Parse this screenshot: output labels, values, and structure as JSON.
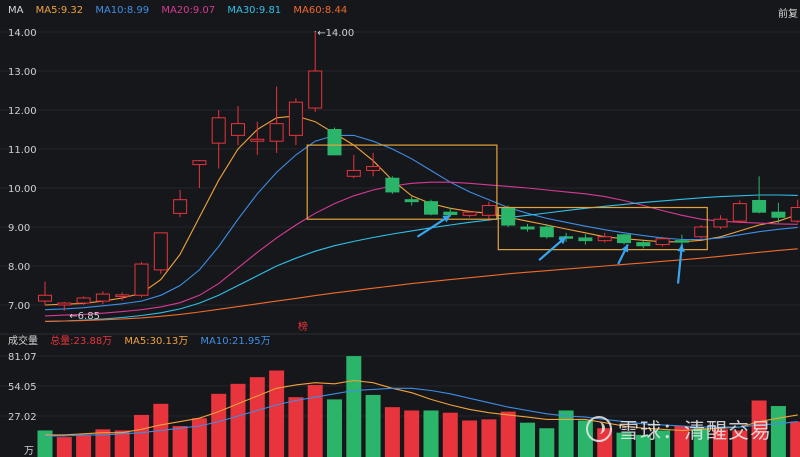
{
  "legend": {
    "ma_label": "MA",
    "ma5": "MA5:9.32",
    "ma10": "MA10:8.99",
    "ma20": "MA20:9.07",
    "ma30": "MA30:9.81",
    "ma60": "MA60:8.44"
  },
  "nav": {
    "right_label": "前复"
  },
  "volume_legend": {
    "title": "成交量",
    "total": "总量:23.88万",
    "ma5": "MA5:30.13万",
    "ma10": "MA10:21.95万"
  },
  "watermark": {
    "text": "雪球：清醒交易"
  },
  "colors": {
    "up": "#e8343c",
    "down": "#2ab56a",
    "ma5": "#f0a23b",
    "ma10": "#3e8ee6",
    "ma20": "#d63a94",
    "ma30": "#2fc0e8",
    "ma60": "#f06a2b",
    "annotation_box": "#e2a33b",
    "arrow": "#38a6ee"
  },
  "chart_data": [
    {
      "type": "candlestick",
      "title": "",
      "xlabel": "",
      "ylabel": "",
      "ylim": [
        6.55,
        14.3
      ],
      "yticks": [
        "14.00",
        "13.00",
        "12.00",
        "11.00",
        "10.00",
        "9.00",
        "8.00",
        "7.00"
      ],
      "ytick_values": [
        14,
        13,
        12,
        11,
        10,
        9,
        8,
        7
      ],
      "annotations": {
        "high": "←14.00",
        "low": "←6.85",
        "marker": "榜"
      },
      "candles": [
        {
          "o": 7.1,
          "h": 7.6,
          "l": 7.0,
          "c": 7.25
        },
        {
          "o": 7.0,
          "h": 7.08,
          "l": 6.85,
          "c": 7.05
        },
        {
          "o": 7.05,
          "h": 7.22,
          "l": 7.0,
          "c": 7.18
        },
        {
          "o": 7.1,
          "h": 7.35,
          "l": 7.02,
          "c": 7.28
        },
        {
          "o": 7.22,
          "h": 7.32,
          "l": 7.12,
          "c": 7.26
        },
        {
          "o": 7.25,
          "h": 8.1,
          "l": 7.2,
          "c": 8.05
        },
        {
          "o": 7.9,
          "h": 8.85,
          "l": 7.8,
          "c": 8.85
        },
        {
          "o": 9.35,
          "h": 9.95,
          "l": 9.25,
          "c": 9.7
        },
        {
          "o": 10.6,
          "h": 10.72,
          "l": 10.0,
          "c": 10.7
        },
        {
          "o": 11.15,
          "h": 12.0,
          "l": 10.5,
          "c": 11.8
        },
        {
          "o": 11.35,
          "h": 12.1,
          "l": 11.1,
          "c": 11.65
        },
        {
          "o": 11.2,
          "h": 11.7,
          "l": 10.85,
          "c": 11.25
        },
        {
          "o": 11.2,
          "h": 12.6,
          "l": 10.9,
          "c": 11.65
        },
        {
          "o": 11.35,
          "h": 12.3,
          "l": 11.1,
          "c": 12.2
        },
        {
          "o": 12.05,
          "h": 14.0,
          "l": 11.95,
          "c": 13.0
        },
        {
          "o": 11.5,
          "h": 11.55,
          "l": 10.85,
          "c": 10.85
        },
        {
          "o": 10.3,
          "h": 10.85,
          "l": 10.25,
          "c": 10.45
        },
        {
          "o": 10.45,
          "h": 10.9,
          "l": 10.3,
          "c": 10.55
        },
        {
          "o": 10.25,
          "h": 10.3,
          "l": 9.85,
          "c": 9.9
        },
        {
          "o": 9.7,
          "h": 9.78,
          "l": 9.55,
          "c": 9.65
        },
        {
          "o": 9.65,
          "h": 9.7,
          "l": 9.3,
          "c": 9.33
        },
        {
          "o": 9.38,
          "h": 9.5,
          "l": 9.27,
          "c": 9.32
        },
        {
          "o": 9.3,
          "h": 9.42,
          "l": 9.25,
          "c": 9.38
        },
        {
          "o": 9.3,
          "h": 9.65,
          "l": 9.15,
          "c": 9.55
        },
        {
          "o": 9.5,
          "h": 9.55,
          "l": 9.0,
          "c": 9.05
        },
        {
          "o": 9.0,
          "h": 9.08,
          "l": 8.88,
          "c": 8.95
        },
        {
          "o": 9.0,
          "h": 9.08,
          "l": 8.7,
          "c": 8.75
        },
        {
          "o": 8.75,
          "h": 8.85,
          "l": 8.62,
          "c": 8.72
        },
        {
          "o": 8.72,
          "h": 8.82,
          "l": 8.55,
          "c": 8.65
        },
        {
          "o": 8.65,
          "h": 8.85,
          "l": 8.6,
          "c": 8.75
        },
        {
          "o": 8.8,
          "h": 8.82,
          "l": 8.55,
          "c": 8.6
        },
        {
          "o": 8.6,
          "h": 8.65,
          "l": 8.45,
          "c": 8.52
        },
        {
          "o": 8.55,
          "h": 8.75,
          "l": 8.5,
          "c": 8.7
        },
        {
          "o": 8.65,
          "h": 8.8,
          "l": 8.55,
          "c": 8.62
        },
        {
          "o": 8.75,
          "h": 9.05,
          "l": 8.7,
          "c": 9.0
        },
        {
          "o": 9.0,
          "h": 9.3,
          "l": 8.95,
          "c": 9.2
        },
        {
          "o": 9.15,
          "h": 9.68,
          "l": 9.1,
          "c": 9.6
        },
        {
          "o": 9.68,
          "h": 10.3,
          "l": 9.35,
          "c": 9.38
        },
        {
          "o": 9.38,
          "h": 9.62,
          "l": 9.1,
          "c": 9.25
        },
        {
          "o": 9.15,
          "h": 9.7,
          "l": 9.1,
          "c": 9.5
        }
      ],
      "ma_series": [
        {
          "name": "MA5",
          "color": "#f0a23b",
          "values": [
            7.0,
            7.02,
            7.04,
            7.1,
            7.18,
            7.3,
            7.65,
            8.3,
            9.25,
            10.2,
            11.0,
            11.5,
            11.8,
            11.85,
            11.7,
            11.4,
            11.1,
            10.7,
            10.2,
            9.8,
            9.6,
            9.48,
            9.4,
            9.35,
            9.25,
            9.15,
            9.05,
            8.95,
            8.85,
            8.75,
            8.7,
            8.66,
            8.62,
            8.62,
            8.66,
            8.75,
            8.9,
            9.05,
            9.15,
            9.32
          ]
        },
        {
          "name": "MA10",
          "color": "#3e8ee6",
          "values": [
            6.88,
            6.9,
            6.93,
            6.98,
            7.03,
            7.1,
            7.25,
            7.5,
            7.9,
            8.5,
            9.2,
            9.85,
            10.4,
            10.85,
            11.2,
            11.35,
            11.35,
            11.2,
            11.0,
            10.75,
            10.45,
            10.15,
            9.9,
            9.7,
            9.5,
            9.35,
            9.22,
            9.12,
            9.02,
            8.93,
            8.85,
            8.78,
            8.72,
            8.68,
            8.68,
            8.72,
            8.8,
            8.88,
            8.94,
            8.99
          ]
        },
        {
          "name": "MA20",
          "color": "#d63a94",
          "values": [
            6.72,
            6.74,
            6.76,
            6.79,
            6.83,
            6.88,
            6.95,
            7.06,
            7.25,
            7.55,
            7.95,
            8.35,
            8.72,
            9.05,
            9.35,
            9.6,
            9.8,
            9.95,
            10.05,
            10.12,
            10.15,
            10.15,
            10.12,
            10.08,
            10.04,
            10.0,
            9.95,
            9.9,
            9.85,
            9.78,
            9.68,
            9.55,
            9.42,
            9.3,
            9.2,
            9.15,
            9.12,
            9.1,
            9.08,
            9.07
          ]
        },
        {
          "name": "MA30",
          "color": "#2fc0e8",
          "values": [
            6.58,
            6.59,
            6.61,
            6.64,
            6.68,
            6.73,
            6.8,
            6.9,
            7.05,
            7.25,
            7.5,
            7.75,
            8.0,
            8.2,
            8.38,
            8.52,
            8.63,
            8.73,
            8.82,
            8.9,
            8.98,
            9.05,
            9.12,
            9.18,
            9.24,
            9.3,
            9.36,
            9.42,
            9.48,
            9.53,
            9.58,
            9.63,
            9.67,
            9.71,
            9.75,
            9.78,
            9.8,
            9.82,
            9.82,
            9.81
          ]
        },
        {
          "name": "MA60",
          "color": "#f06a2b",
          "values": [
            6.58,
            6.59,
            6.6,
            6.62,
            6.64,
            6.67,
            6.71,
            6.76,
            6.82,
            6.89,
            6.96,
            7.03,
            7.1,
            7.17,
            7.24,
            7.31,
            7.37,
            7.43,
            7.49,
            7.55,
            7.6,
            7.65,
            7.7,
            7.75,
            7.8,
            7.84,
            7.88,
            7.92,
            7.96,
            8.0,
            8.04,
            8.08,
            8.12,
            8.16,
            8.2,
            8.25,
            8.3,
            8.35,
            8.4,
            8.44
          ]
        }
      ],
      "annotation_boxes": [
        {
          "from_index": 14,
          "to_index": 23,
          "y_top": 11.1,
          "y_bottom": 9.2
        },
        {
          "from_index": 23.9,
          "to_index": 33.9,
          "y_top": 9.5,
          "y_bottom": 8.42
        }
      ],
      "arrows": [
        {
          "index": 21,
          "value": 9.3,
          "tail_index": 19.3,
          "tail_value": 8.75
        },
        {
          "index": 27,
          "value": 8.75,
          "tail_index": 25.6,
          "tail_value": 8.15
        },
        {
          "index": 30.2,
          "value": 8.55,
          "tail_index": 29.7,
          "tail_value": 8.05
        },
        {
          "index": 33,
          "value": 8.55,
          "tail_index": 32.8,
          "tail_value": 7.55
        }
      ]
    },
    {
      "type": "bar",
      "title": "",
      "ylim": [
        0,
        82
      ],
      "yticks": [
        "81.07",
        "54.05",
        "27.02",
        "万"
      ],
      "ytick_values": [
        81.07,
        54.05,
        27.02
      ],
      "bars": [
        {
          "v": 14,
          "up": false
        },
        {
          "v": 8,
          "up": true
        },
        {
          "v": 10,
          "up": true
        },
        {
          "v": 15,
          "up": true
        },
        {
          "v": 14,
          "up": true
        },
        {
          "v": 28,
          "up": true
        },
        {
          "v": 38,
          "up": true
        },
        {
          "v": 18,
          "up": true
        },
        {
          "v": 25,
          "up": true
        },
        {
          "v": 47,
          "up": true
        },
        {
          "v": 56,
          "up": true
        },
        {
          "v": 62,
          "up": true
        },
        {
          "v": 68,
          "up": true
        },
        {
          "v": 44,
          "up": true
        },
        {
          "v": 55,
          "up": true
        },
        {
          "v": 42,
          "up": false
        },
        {
          "v": 81,
          "up": false
        },
        {
          "v": 46,
          "up": false
        },
        {
          "v": 35,
          "up": true
        },
        {
          "v": 32,
          "up": true
        },
        {
          "v": 32,
          "up": false
        },
        {
          "v": 30,
          "up": true
        },
        {
          "v": 23,
          "up": true
        },
        {
          "v": 24,
          "up": true
        },
        {
          "v": 31,
          "up": true
        },
        {
          "v": 21,
          "up": false
        },
        {
          "v": 16,
          "up": false
        },
        {
          "v": 32,
          "up": false
        },
        {
          "v": 23,
          "up": false
        },
        {
          "v": 16,
          "up": true
        },
        {
          "v": 12,
          "up": false
        },
        {
          "v": 10,
          "up": false
        },
        {
          "v": 14,
          "up": false
        },
        {
          "v": 18,
          "up": true
        },
        {
          "v": 16,
          "up": false
        },
        {
          "v": 15,
          "up": true
        },
        {
          "v": 14,
          "up": true
        },
        {
          "v": 41,
          "up": true
        },
        {
          "v": 36,
          "up": false
        },
        {
          "v": 22,
          "up": true
        }
      ],
      "ma_series": [
        {
          "name": "MA5",
          "color": "#f0a23b",
          "values": [
            10,
            10,
            11,
            12,
            12,
            15,
            19,
            22,
            25,
            31,
            38,
            45,
            52,
            55,
            57,
            56,
            59,
            57,
            52,
            48,
            42,
            37,
            33,
            30,
            28,
            26,
            24,
            24,
            24,
            21,
            18,
            16,
            15,
            14,
            15,
            16,
            17,
            22,
            25,
            28
          ]
        },
        {
          "name": "MA10",
          "color": "#3e8ee6",
          "values": [
            9,
            9,
            10,
            10,
            11,
            12,
            14,
            16,
            18,
            22,
            27,
            32,
            37,
            41,
            44,
            47,
            50,
            51,
            52,
            52,
            50,
            47,
            43,
            39,
            35,
            32,
            29,
            27,
            26,
            24,
            22,
            20,
            19,
            18,
            17,
            17,
            17,
            19,
            20,
            22
          ]
        }
      ]
    }
  ]
}
